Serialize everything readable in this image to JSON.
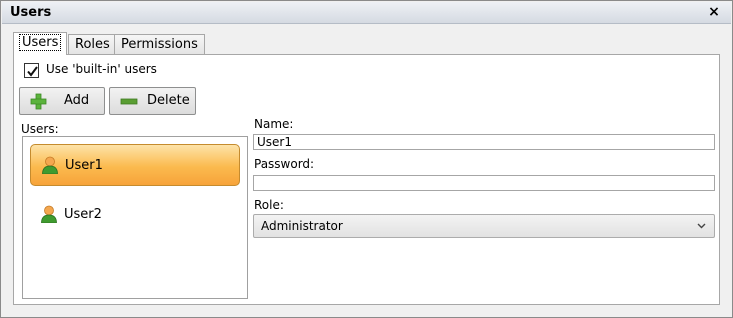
{
  "window": {
    "title": "Users",
    "close_glyph": "×"
  },
  "tabs": [
    {
      "label": "Users",
      "active": true
    },
    {
      "label": "Roles",
      "active": false
    },
    {
      "label": "Permissions",
      "active": false
    }
  ],
  "builtin_checkbox": {
    "label": "Use 'built-in' users",
    "checked": true
  },
  "toolbar": {
    "add_label": "Add",
    "delete_label": "Delete"
  },
  "users_panel": {
    "label": "Users:",
    "items": [
      {
        "name": "User1",
        "selected": true,
        "icon": "user-icon"
      },
      {
        "name": "User2",
        "selected": false,
        "icon": "user-icon"
      }
    ]
  },
  "form": {
    "name_label": "Name:",
    "name_value": "User1",
    "password_label": "Password:",
    "password_value": "",
    "role_label": "Role:",
    "role_value": "Administrator"
  },
  "colors": {
    "selection": "#fbba4e",
    "add_icon": "#5bb33c",
    "delete_icon": "#5a9e33",
    "user_head": "#f4a74f",
    "user_body": "#3f9b2f"
  }
}
